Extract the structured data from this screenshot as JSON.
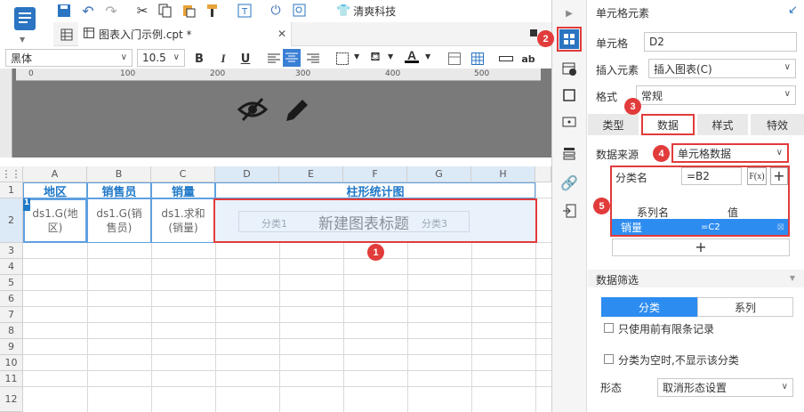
{
  "toolbar": {
    "brand_label": "清爽科技",
    "tab_title": "图表入门示例.cpt *",
    "font_name": "黑体",
    "font_size": "10.5",
    "bold": "B",
    "italic": "I",
    "underline": "U",
    "abc": "ab"
  },
  "ruler": {
    "ticks": [
      "0",
      "100",
      "200",
      "300",
      "400",
      "500"
    ]
  },
  "sheet": {
    "columns": [
      "A",
      "B",
      "C",
      "D",
      "E",
      "F",
      "G",
      "H"
    ],
    "rows": [
      "1",
      "2",
      "3",
      "4",
      "5",
      "6",
      "7",
      "8",
      "9",
      "10",
      "11",
      "12"
    ],
    "row1": {
      "a": "地区",
      "b": "销售员",
      "c": "销量",
      "d": "柱形统计图"
    },
    "row2": {
      "a": "ds1.G(地区)",
      "b": "ds1.G(销售员)",
      "c": "ds1.求和(销量)"
    },
    "chart_title": "新建图表标题",
    "chart_ghost": [
      "分类1",
      "分类3"
    ]
  },
  "panel": {
    "header": "单元格元素",
    "cell_label": "单元格",
    "cell_value": "D2",
    "insert_label": "插入元素",
    "insert_value": "插入图表(C)",
    "format_label": "格式",
    "format_value": "常规",
    "tabs": [
      "类型",
      "数据",
      "样式",
      "特效"
    ],
    "source_label": "数据来源",
    "source_value": "单元格数据",
    "category_label": "分类名",
    "category_value": "=B2",
    "fx_label": "F(x)",
    "series_header": "系列名",
    "value_header": "值",
    "series_row_name": "销量",
    "series_row_value": "=C2",
    "filter_header": "数据筛选",
    "filter_tabs": [
      "分类",
      "系列"
    ],
    "check1": "只使用前有限条记录",
    "check2": "分类为空时,不显示该分类",
    "shape_label": "形态",
    "shape_value": "取消形态设置"
  },
  "badges": [
    "1",
    "2",
    "3",
    "4",
    "5"
  ],
  "colors": {
    "accent": "#1e78c8",
    "badge": "#e23b3b",
    "selected": "#2d8cf0"
  }
}
